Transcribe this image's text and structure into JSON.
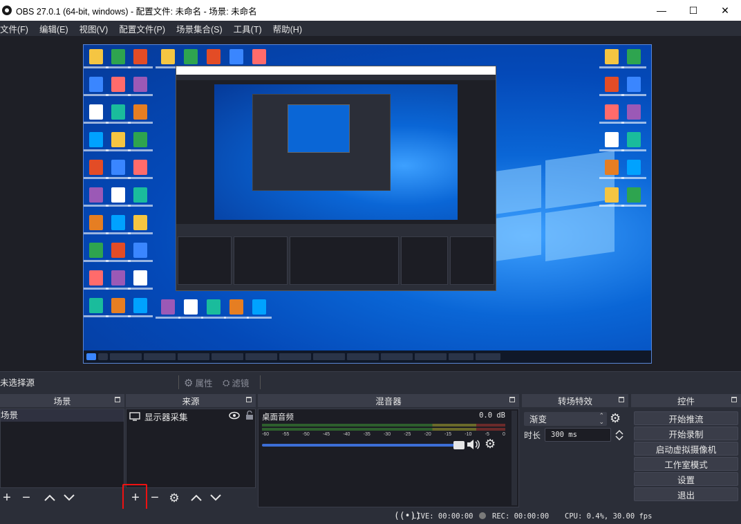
{
  "window": {
    "title": "OBS 27.0.1 (64-bit, windows) - 配置文件: 未命名 - 场景: 未命名",
    "minimize": "—",
    "maximize": "☐",
    "close": "✕"
  },
  "menu": [
    "文件(F)",
    "编辑(E)",
    "视图(V)",
    "配置文件(P)",
    "场景集合(S)",
    "工具(T)",
    "帮助(H)"
  ],
  "source_toolbar": {
    "no_selection": "未选择源",
    "properties": "属性",
    "filters": "滤镜"
  },
  "docks": {
    "scenes": {
      "title": "场景",
      "items": [
        "场景"
      ]
    },
    "sources": {
      "title": "来源",
      "items": [
        {
          "name": "显示器采集",
          "visible": true,
          "locked": false
        }
      ]
    },
    "mixer": {
      "title": "混音器",
      "channel": "桌面音频",
      "level": "0.0 dB",
      "ticks": [
        "-60",
        "-55",
        "-50",
        "-45",
        "-40",
        "-35",
        "-30",
        "-25",
        "-20",
        "-15",
        "-10",
        "-5",
        "0"
      ]
    },
    "transitions": {
      "title": "转场特效",
      "selected": "渐变",
      "duration_label": "时长",
      "duration_value": "300 ms"
    },
    "controls": {
      "title": "控件",
      "buttons": [
        "开始推流",
        "开始录制",
        "启动虚拟摄像机",
        "工作室模式",
        "设置",
        "退出"
      ]
    }
  },
  "status": {
    "live": "LIVE: 00:00:00",
    "rec": "REC: 00:00:00",
    "cpu": "CPU: 0.4%, 30.00 fps"
  },
  "colors": {
    "background": "#2b2e38",
    "panel": "#1c1d24",
    "accent": "#3c6ed6",
    "highlight": "#ee1111"
  }
}
